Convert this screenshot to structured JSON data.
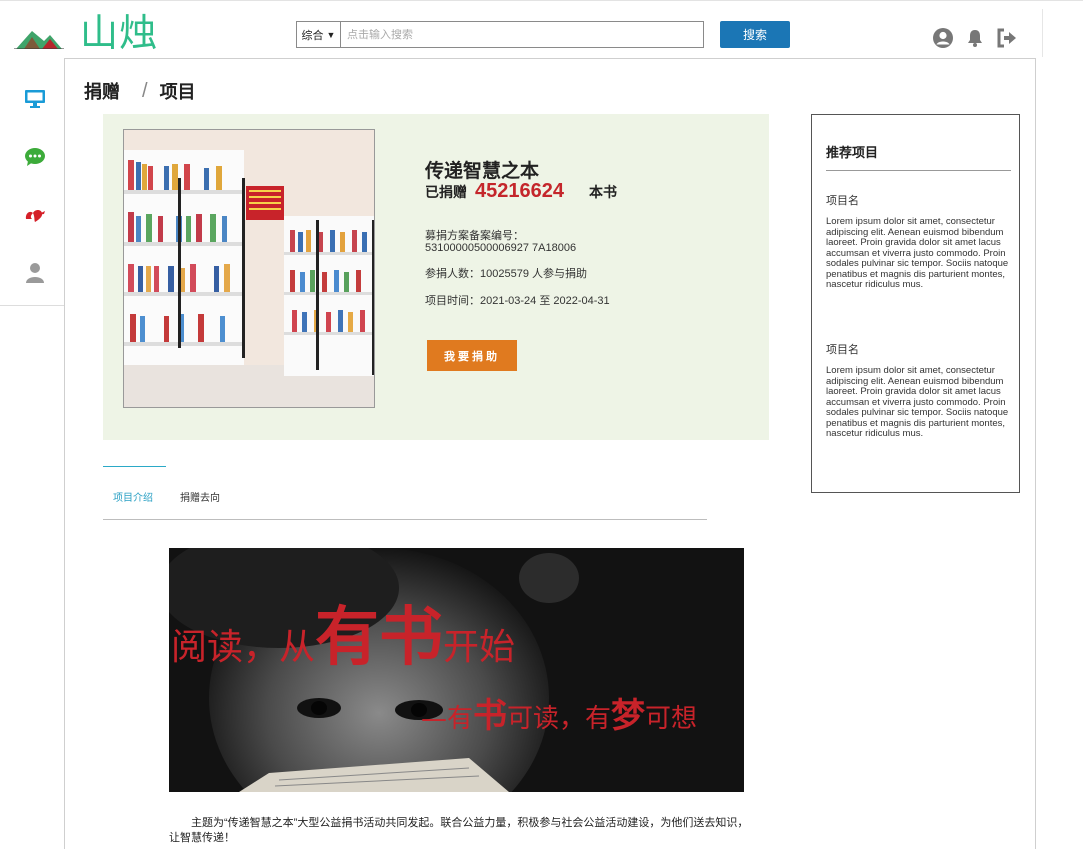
{
  "header": {
    "brand": "山烛",
    "search_select": "综合",
    "search_placeholder": "点击输入搜索",
    "search_button": "搜索",
    "icons": [
      "user-circle-icon",
      "bell-icon",
      "sign-out-icon"
    ]
  },
  "sidebar": {
    "items": [
      "monitor-icon",
      "chat-icon",
      "charity-icon",
      "user-icon"
    ]
  },
  "breadcrumb": {
    "part1": "捐赠",
    "separator": "/",
    "part2": "项目"
  },
  "project": {
    "title": "传递智慧之本",
    "donated_label": "已捐赠",
    "donated_count": "45216624",
    "donated_unit": "本书",
    "record_label": "募捐方案备案编号：",
    "record_number": "53100000500006927 7A18006",
    "participants": "参捐人数：10025579 人参与捐助",
    "period": "项目时间：2021-03-24 至 2022-04-31",
    "donate_button": "我要捐助"
  },
  "tabs": {
    "intro": "项目介绍",
    "whereabouts": "捐赠去向"
  },
  "banner": {
    "line1_a": "阅读，从",
    "line1_b": "有书",
    "line1_c": "开始",
    "line2_a": "—有",
    "line2_b": "书",
    "line2_c": "可读，有",
    "line2_d": "梦",
    "line2_e": "可想"
  },
  "intro_text": "主题为“传递智慧之本”大型公益捐书活动共同发起。联合公益力量，积极参与社会公益活动建设，为他们送去知识，让智慧传递！",
  "recommend": {
    "title": "推荐项目",
    "items": [
      {
        "name": "项目名",
        "desc": "Lorem ipsum dolor sit amet, consectetur adipiscing elit. Aenean euismod bibendum laoreet. Proin gravida dolor sit amet lacus accumsan et viverra justo commodo. Proin sodales pulvinar sic tempor. Sociis natoque penatibus et magnis dis parturient montes, nascetur ridiculus mus."
      },
      {
        "name": "项目名",
        "desc": "Lorem ipsum dolor sit amet, consectetur adipiscing elit. Aenean euismod bibendum laoreet. Proin gravida dolor sit amet lacus accumsan et viverra justo commodo. Proin sodales pulvinar sic tempor. Sociis natoque penatibus et magnis dis parturient montes, nascetur ridiculus mus."
      }
    ]
  },
  "colors": {
    "brand": "#2fbd8a",
    "accent_blue": "#1b76b5",
    "donate_orange": "#e07a1f",
    "highlight_red": "#c4262b",
    "card_bg": "#eef4e6"
  }
}
